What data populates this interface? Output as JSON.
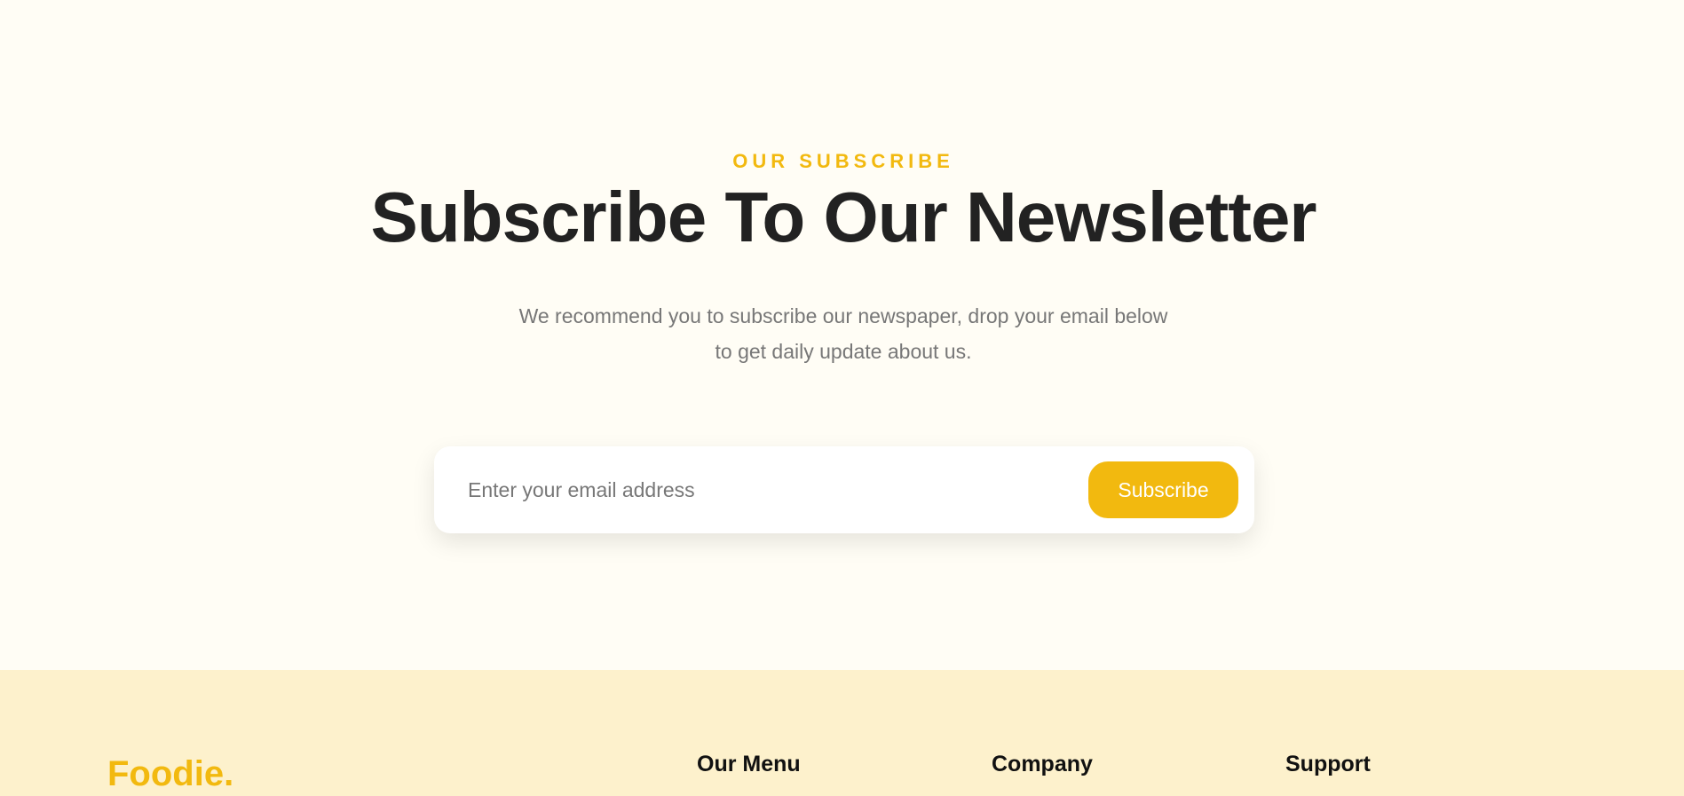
{
  "subscribe": {
    "eyebrow": "OUR SUBSCRIBE",
    "title": "Subscribe To Our Newsletter",
    "description": [
      "We recommend you to subscribe our newspaper, drop your email below",
      "to get daily update about us."
    ],
    "email_placeholder": "Enter your email address",
    "email_value": "",
    "button_label": "Subscribe"
  },
  "footer": {
    "brand": "Foodie.",
    "headings": {
      "menu": "Our Menu",
      "company": "Company",
      "support": "Support"
    }
  },
  "colors": {
    "page_background": "#fffdf5",
    "footer_background": "#fdf1cc",
    "accent": "#f2b90f",
    "heading": "#222222",
    "body_text": "#777777"
  }
}
